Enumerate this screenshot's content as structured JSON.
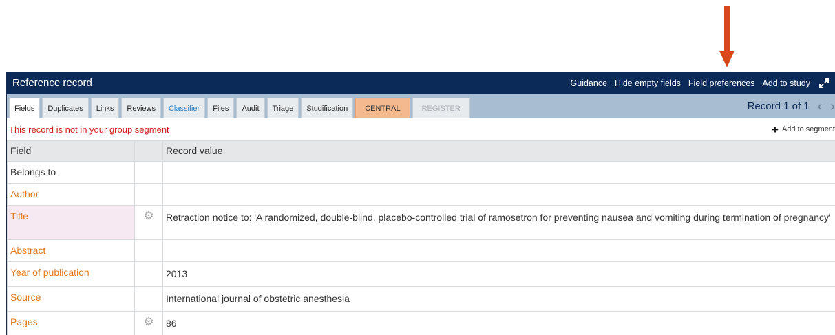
{
  "header": {
    "title": "Reference record",
    "actions": [
      "Guidance",
      "Hide empty fields",
      "Field preferences",
      "Add to study"
    ]
  },
  "tabs": [
    {
      "label": "Fields"
    },
    {
      "label": "Duplicates"
    },
    {
      "label": "Links"
    },
    {
      "label": "Reviews"
    },
    {
      "label": "Classifier"
    },
    {
      "label": "Files"
    },
    {
      "label": "Audit"
    },
    {
      "label": "Triage"
    },
    {
      "label": "Studification"
    },
    {
      "label": "CENTRAL"
    },
    {
      "label": "REGISTER"
    }
  ],
  "record_nav": {
    "label": "Record 1 of 1",
    "prev": "‹",
    "next": "›"
  },
  "segment": {
    "warning": "This record is not in your group segment",
    "add_label": "Add to segment"
  },
  "table": {
    "headers": [
      "Field",
      "",
      "Record value"
    ],
    "rows": [
      {
        "field": "Belongs to",
        "value": ""
      },
      {
        "field": "Author",
        "value": ""
      },
      {
        "field": "Title",
        "value": "Retraction notice to: 'A randomized, double-blind, placebo-controlled trial of ramosetron for preventing nausea and vomiting during termination of pregnancy'"
      },
      {
        "field": "Abstract",
        "value": ""
      },
      {
        "field": "Year of publication",
        "value": "2013"
      },
      {
        "field": "Source",
        "value": "International journal of obstetric anesthesia"
      },
      {
        "field": "Pages",
        "value": "86"
      }
    ]
  },
  "colors": {
    "header_bg": "#0b2a57",
    "tabbar_bg": "#a9bdd2",
    "central_tab": "#f4b98d",
    "field_orange": "#e07a1e",
    "warning_red": "#cc1f1f",
    "arrow": "#d9481c"
  },
  "icons": {
    "expand": "expand-icon",
    "gear": "gear-icon",
    "plus": "plus-icon",
    "arrow": "down-arrow-annotation"
  }
}
